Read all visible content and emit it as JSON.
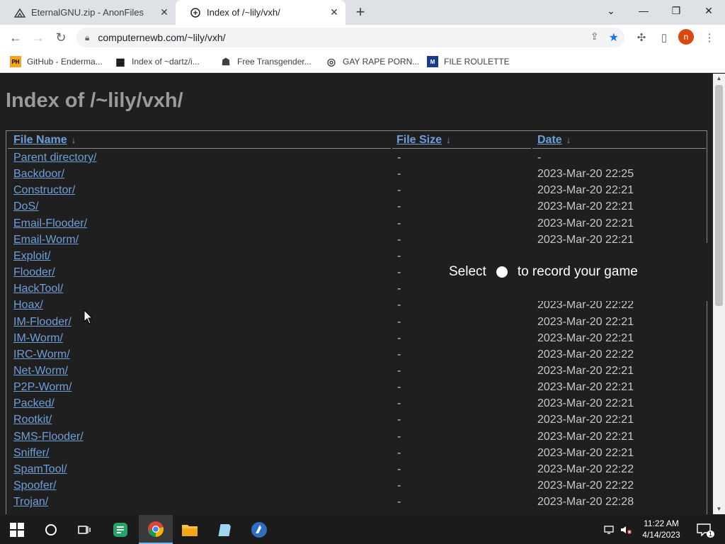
{
  "tabs": [
    {
      "title": "EternalGNU.zip - AnonFiles",
      "icon": "anonfiles-icon"
    },
    {
      "title": "Index of /~lily/vxh/",
      "icon": "page-icon"
    }
  ],
  "window_controls": {
    "minimize": "—",
    "maximize": "❐",
    "close": "✕",
    "tab_search": "⌄"
  },
  "toolbar": {
    "url": "computernewb.com/~lily/vxh/",
    "profile_initial": "n"
  },
  "bookmarks": [
    {
      "label": "GitHub - Enderma...",
      "icon_text": "PH"
    },
    {
      "label": "Index of ~dartz/i...",
      "icon_text": "▦"
    },
    {
      "label": "Free Transgender...",
      "icon_text": "☗"
    },
    {
      "label": "GAY RAPE PORN...",
      "icon_text": "◎"
    },
    {
      "label": "FILE ROULETTE",
      "icon_text": "M"
    }
  ],
  "page": {
    "title": "Index of /~lily/vxh/",
    "columns": {
      "name": "File Name",
      "size": "File Size",
      "date": "Date",
      "sort_arrow": "↓"
    },
    "rows": [
      {
        "name": "Parent directory/",
        "size": "-",
        "date": "-"
      },
      {
        "name": "Backdoor/",
        "size": "-",
        "date": "2023-Mar-20 22:25"
      },
      {
        "name": "Constructor/",
        "size": "-",
        "date": "2023-Mar-20 22:21"
      },
      {
        "name": "DoS/",
        "size": "-",
        "date": "2023-Mar-20 22:21"
      },
      {
        "name": "Email-Flooder/",
        "size": "-",
        "date": "2023-Mar-20 22:21"
      },
      {
        "name": "Email-Worm/",
        "size": "-",
        "date": "2023-Mar-20 22:21"
      },
      {
        "name": "Exploit/",
        "size": "-",
        "date": ""
      },
      {
        "name": "Flooder/",
        "size": "-",
        "date": ""
      },
      {
        "name": "HackTool/",
        "size": "-",
        "date": ""
      },
      {
        "name": "Hoax/",
        "size": "-",
        "date": "2023-Mar-20 22:22"
      },
      {
        "name": "IM-Flooder/",
        "size": "-",
        "date": "2023-Mar-20 22:21"
      },
      {
        "name": "IM-Worm/",
        "size": "-",
        "date": "2023-Mar-20 22:21"
      },
      {
        "name": "IRC-Worm/",
        "size": "-",
        "date": "2023-Mar-20 22:22"
      },
      {
        "name": "Net-Worm/",
        "size": "-",
        "date": "2023-Mar-20 22:21"
      },
      {
        "name": "P2P-Worm/",
        "size": "-",
        "date": "2023-Mar-20 22:21"
      },
      {
        "name": "Packed/",
        "size": "-",
        "date": "2023-Mar-20 22:21"
      },
      {
        "name": "Rootkit/",
        "size": "-",
        "date": "2023-Mar-20 22:21"
      },
      {
        "name": "SMS-Flooder/",
        "size": "-",
        "date": "2023-Mar-20 22:21"
      },
      {
        "name": "Sniffer/",
        "size": "-",
        "date": "2023-Mar-20 22:21"
      },
      {
        "name": "SpamTool/",
        "size": "-",
        "date": "2023-Mar-20 22:22"
      },
      {
        "name": "Spoofer/",
        "size": "-",
        "date": "2023-Mar-20 22:22"
      },
      {
        "name": "Trojan/",
        "size": "-",
        "date": "2023-Mar-20 22:28"
      }
    ]
  },
  "overlay": {
    "text_before": "Select",
    "text_after": "to record your game"
  },
  "taskbar": {
    "clock_time": "11:22 AM",
    "clock_date": "4/14/2023",
    "notification_count": "1"
  },
  "colors": {
    "link": "#6f9ed9",
    "page_bg": "#1f1f1f",
    "title": "#9a9a9a",
    "bookmark_star": "#1a73e8",
    "profile": "#d9480f"
  }
}
